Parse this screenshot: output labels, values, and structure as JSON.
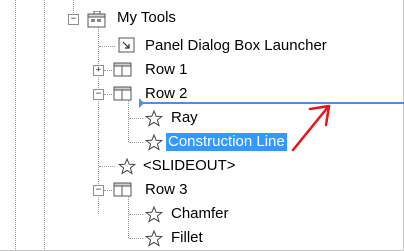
{
  "tree": {
    "root": {
      "label": "My Tools",
      "expander": "−"
    },
    "items": [
      {
        "label": "Panel Dialog Box Launcher"
      },
      {
        "label": "Row 1",
        "expander": "+"
      },
      {
        "label": "Row 2",
        "expander": "−"
      },
      {
        "label": "Ray"
      },
      {
        "label": "Construction Line",
        "selected": true
      },
      {
        "label": "<SLIDEOUT>"
      },
      {
        "label": "Row 3",
        "expander": "−"
      },
      {
        "label": "Chamfer"
      },
      {
        "label": "Fillet"
      }
    ]
  },
  "colors": {
    "selection": "#3399ff",
    "drop_indicator": "#4a90e2",
    "annotation_arrow": "#e8141a"
  },
  "icons": {
    "root": "toolbar-icon",
    "launcher": "dialog-launcher-icon",
    "row": "panel-row-icon",
    "command": "star-outline-icon"
  }
}
